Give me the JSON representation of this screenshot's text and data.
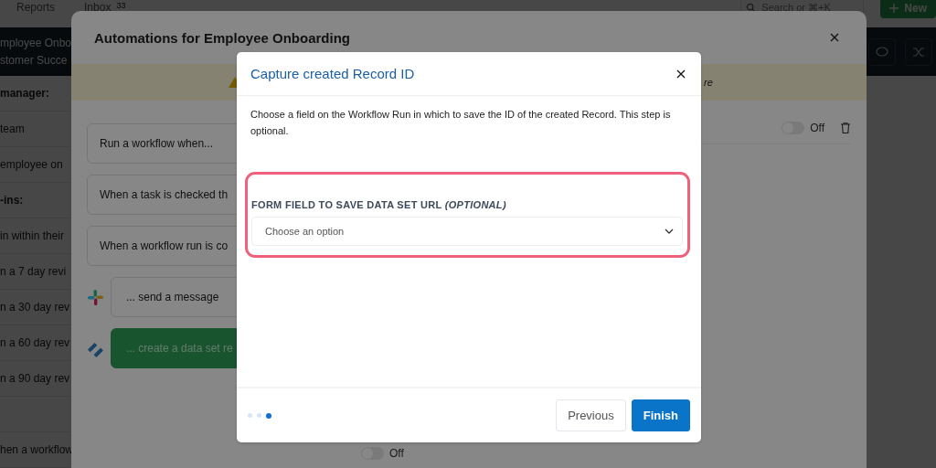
{
  "top_nav": {
    "items": [
      {
        "label": "Reports"
      },
      {
        "label": "Inbox",
        "badge": "33"
      }
    ],
    "search": {
      "placeholder": "Search or ⌘+K"
    },
    "new_button": "New"
  },
  "sidebar": {
    "header": [
      "mployee Onbo",
      "stomer Succe"
    ],
    "rows": [
      {
        "kind": "heading",
        "text": "manager:"
      },
      {
        "kind": "item",
        "text": "team"
      },
      {
        "kind": "item",
        "text": "employee on"
      },
      {
        "kind": "heading",
        "text": "-ins:"
      },
      {
        "kind": "item",
        "text": "in within their"
      },
      {
        "kind": "item",
        "text": "n a 7 day revi"
      },
      {
        "kind": "item",
        "text": "n a 30 day rev"
      },
      {
        "kind": "item",
        "text": "n a 60 day rev"
      },
      {
        "kind": "item",
        "text": "n a 90 day rev"
      },
      {
        "kind": "spacer"
      },
      {
        "kind": "item",
        "text": "hen a workflow"
      }
    ]
  },
  "automations_modal": {
    "title": "Automations for Employee Onboarding",
    "banner": {
      "text": "re"
    },
    "triggers": [
      {
        "kind": "trigger",
        "text": "Run a workflow when..."
      },
      {
        "kind": "trigger",
        "text": "When a task is checked th"
      },
      {
        "kind": "trigger",
        "text": "When a workflow run is co"
      },
      {
        "kind": "slack",
        "text": "... send a message"
      },
      {
        "kind": "dataset",
        "text": "... create a data set re"
      }
    ],
    "toggles": [
      {
        "on": false,
        "label": "Off",
        "deletable": true
      },
      {
        "on": false,
        "label": "Off",
        "deletable": false
      }
    ]
  },
  "capture_modal": {
    "title": "Capture created Record ID",
    "description": "Choose a field on the Workflow Run in which to save the ID of the created Record. This step is optional.",
    "field": {
      "label": "FORM FIELD TO SAVE DATA SET URL *(OPTIONAL)*",
      "placeholder": "Choose an option",
      "highlighted": true
    },
    "steps": [
      {
        "selected": false
      },
      {
        "selected": false
      },
      {
        "selected": true
      }
    ],
    "buttons": [
      {
        "kind": "secondary",
        "label": "Previous"
      },
      {
        "kind": "primary",
        "label": "Finish"
      }
    ]
  }
}
